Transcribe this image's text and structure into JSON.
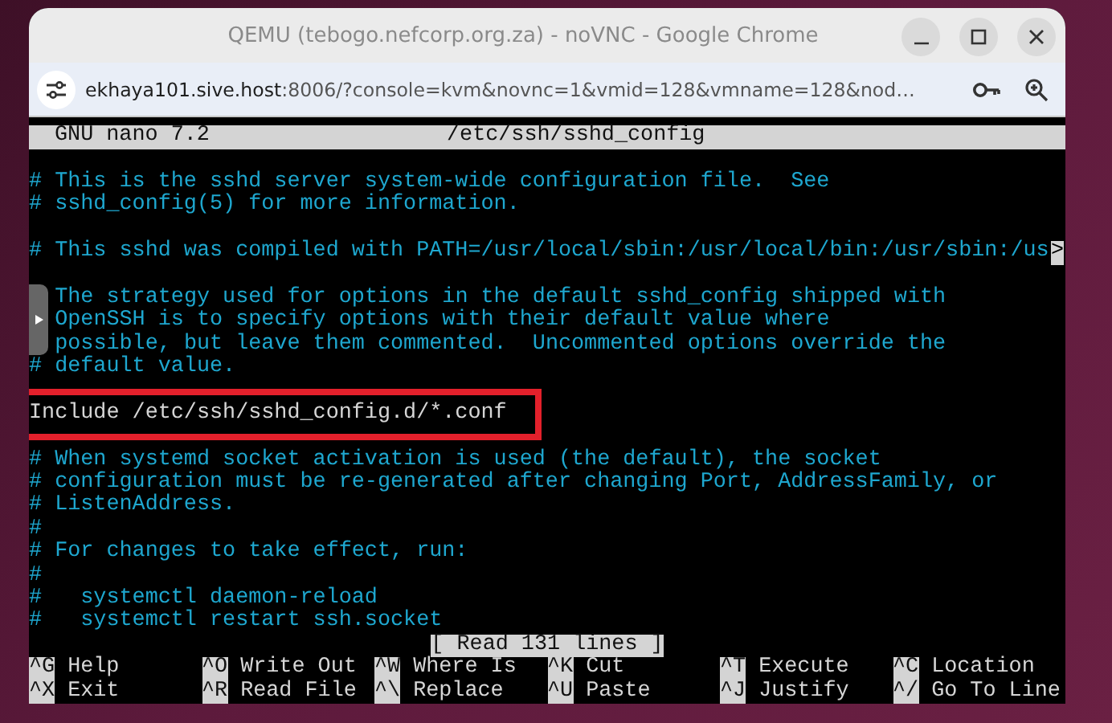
{
  "window": {
    "title": "QEMU (tebogo.nefcorp.org.za) - noVNC - Google Chrome",
    "url_host": "ekhaya101.sive.host",
    "url_rest": ":8006/?console=kvm&novnc=1&vmid=128&vmname=128&nod…"
  },
  "editor": {
    "header_left": "GNU nano 7.2",
    "header_center": "/etc/ssh/sshd_config",
    "lines": [
      {
        "kind": "blank"
      },
      {
        "kind": "comment",
        "text": "# This is the sshd server system-wide configuration file.  See"
      },
      {
        "kind": "comment",
        "text": "# sshd_config(5) for more information."
      },
      {
        "kind": "blank"
      },
      {
        "kind": "comment",
        "text": "# This sshd was compiled with PATH=/usr/local/sbin:/usr/local/bin:/usr/sbin:/us",
        "overflow_mark": ">"
      },
      {
        "kind": "blank"
      },
      {
        "kind": "comment",
        "text": "The strategy used for options in the default sshd_config shipped with",
        "marker_covered": true
      },
      {
        "kind": "comment",
        "text": "OpenSSH is to specify options with their default value where",
        "marker_covered": true
      },
      {
        "kind": "comment",
        "text": "possible, but leave them commented.  Uncommented options override the",
        "marker_covered": true
      },
      {
        "kind": "comment",
        "text": "# default value."
      },
      {
        "kind": "blank"
      },
      {
        "kind": "directive",
        "text": "Include /etc/ssh/sshd_config.d/*.conf",
        "highlighted": true
      },
      {
        "kind": "blank"
      },
      {
        "kind": "comment",
        "text": "# When systemd socket activation is used (the default), the socket"
      },
      {
        "kind": "comment",
        "text": "# configuration must be re-generated after changing Port, AddressFamily, or"
      },
      {
        "kind": "comment",
        "text": "# ListenAddress."
      },
      {
        "kind": "comment",
        "text": "#"
      },
      {
        "kind": "comment",
        "text": "# For changes to take effect, run:"
      },
      {
        "kind": "comment",
        "text": "#"
      },
      {
        "kind": "comment",
        "text": "#   systemctl daemon-reload"
      },
      {
        "kind": "comment",
        "text": "#   systemctl restart ssh.socket"
      }
    ],
    "status": "[ Read 131 lines ]",
    "shortcuts": [
      [
        {
          "key": "^G",
          "label": "Help"
        },
        {
          "key": "^O",
          "label": "Write Out"
        },
        {
          "key": "^W",
          "label": "Where Is"
        },
        {
          "key": "^K",
          "label": "Cut"
        },
        {
          "key": "^T",
          "label": "Execute"
        },
        {
          "key": "^C",
          "label": "Location"
        }
      ],
      [
        {
          "key": "^X",
          "label": "Exit"
        },
        {
          "key": "^R",
          "label": "Read File"
        },
        {
          "key": "^\\",
          "label": "Replace"
        },
        {
          "key": "^U",
          "label": "Paste"
        },
        {
          "key": "^J",
          "label": "Justify"
        },
        {
          "key": "^/",
          "label": "Go To Line"
        }
      ]
    ]
  }
}
